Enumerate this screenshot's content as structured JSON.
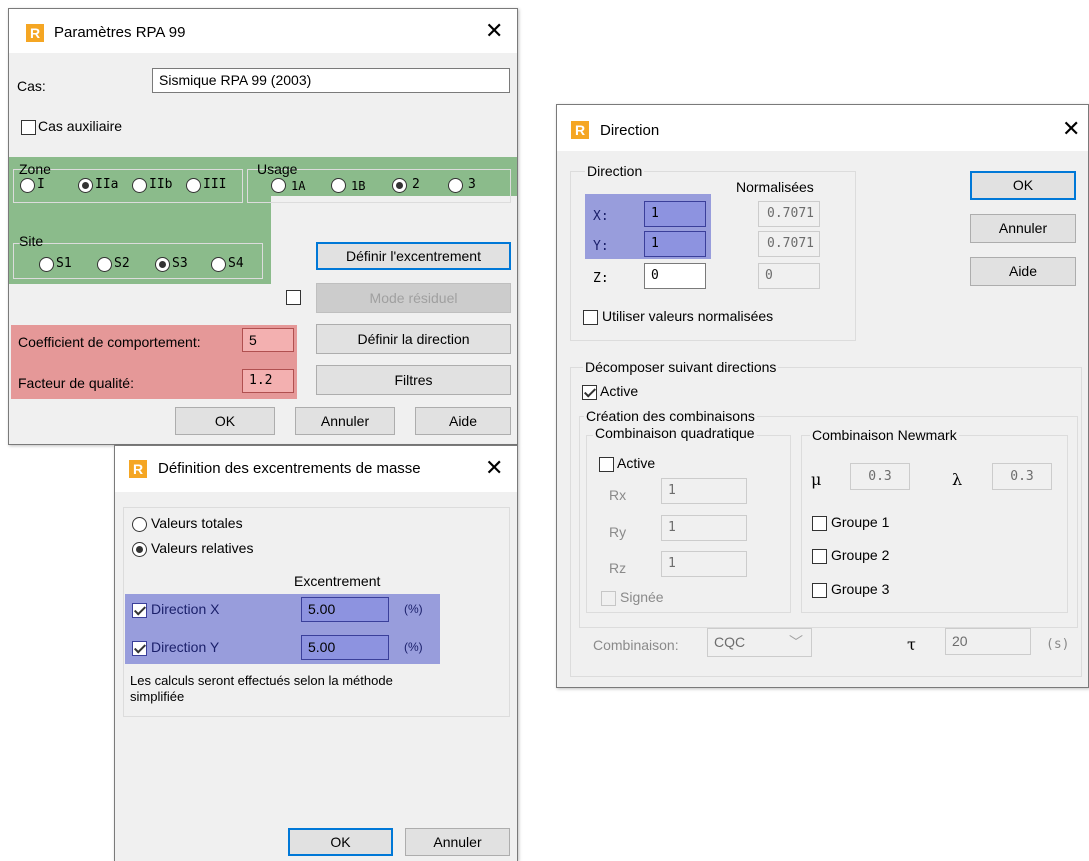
{
  "params": {
    "title": "Paramètres RPA 99",
    "cas_label": "Cas:",
    "cas_value": "Sismique RPA 99 (2003)",
    "cas_aux": "Cas auxiliaire",
    "zone_label": "Zone",
    "zone_options": [
      "I",
      "IIa",
      "IIb",
      "III"
    ],
    "zone_selected": "IIa",
    "usage_label": "Usage",
    "usage_options": [
      "1A",
      "1B",
      "2",
      "3"
    ],
    "usage_selected": "2",
    "site_label": "Site",
    "site_options": [
      "S1",
      "S2",
      "S3",
      "S4"
    ],
    "site_selected": "S3",
    "btn_excentrement": "Définir l'excentrement",
    "btn_mode_residuel": "Mode résiduel",
    "btn_direction": "Définir la direction",
    "btn_filtres": "Filtres",
    "coef_label": "Coefficient de comportement:",
    "coef_value": "5",
    "facteur_label": "Facteur de qualité:",
    "facteur_value": "1.2",
    "ok": "OK",
    "annuler": "Annuler",
    "aide": "Aide"
  },
  "excent": {
    "title": "Définition des excentrements de masse",
    "valeurs_totales": "Valeurs totales",
    "valeurs_relatives": "Valeurs relatives",
    "selected": "Valeurs relatives",
    "excentrement_header": "Excentrement",
    "dir_x_label": "Direction X",
    "dir_x_value": "5.00",
    "dir_y_label": "Direction Y",
    "dir_y_value": "5.00",
    "unit": "(%)",
    "note": "Les calculs seront effectués selon la méthode simplifiée",
    "ok": "OK",
    "annuler": "Annuler"
  },
  "direction": {
    "title": "Direction",
    "group_direction": "Direction",
    "normalisees": "Normalisées",
    "x_label": "X:",
    "x_value": "1",
    "x_norm": "0.7071",
    "y_label": "Y:",
    "y_value": "1",
    "y_norm": "0.7071",
    "z_label": "Z:",
    "z_value": "0",
    "z_norm": "0",
    "utiliser": "Utiliser valeurs normalisées",
    "ok": "OK",
    "annuler": "Annuler",
    "aide": "Aide",
    "decomposer": "Décomposer suivant directions",
    "active": "Active",
    "creation": "Création des combinaisons",
    "quad_label": "Combinaison quadratique",
    "quad_active": "Active",
    "rx_label": "Rx",
    "rx_value": "1",
    "ry_label": "Ry",
    "ry_value": "1",
    "rz_label": "Rz",
    "rz_value": "1",
    "signee": "Signée",
    "newmark_label": "Combinaison Newmark",
    "mu_symbol": "μ",
    "mu_value": "0.3",
    "lambda_symbol": "λ",
    "lambda_value": "0.3",
    "groupe1": "Groupe 1",
    "groupe2": "Groupe 2",
    "groupe3": "Groupe 3",
    "combinaison_label": "Combinaison:",
    "combinaison_value": "CQC",
    "tau_symbol": "τ",
    "tau_value": "20",
    "tau_unit": "(s)"
  }
}
